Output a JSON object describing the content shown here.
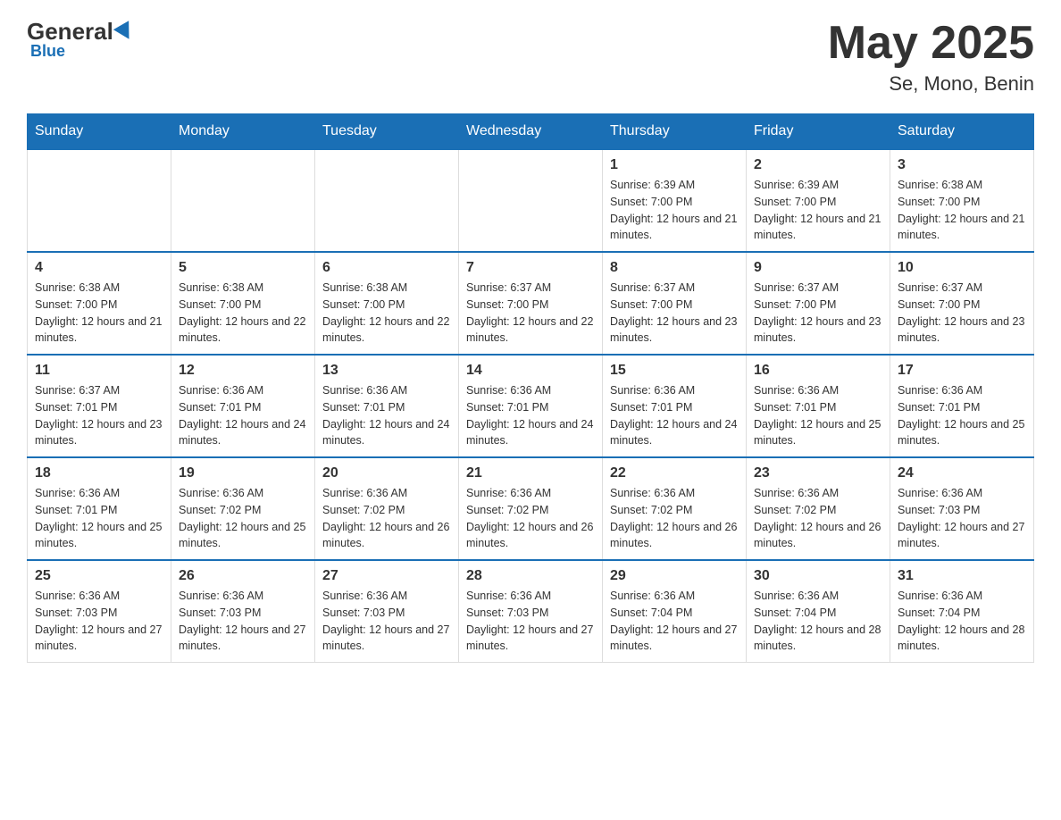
{
  "header": {
    "logo": {
      "general": "General",
      "blue": "Blue"
    },
    "title": "May 2025",
    "location": "Se, Mono, Benin"
  },
  "weekdays": [
    "Sunday",
    "Monday",
    "Tuesday",
    "Wednesday",
    "Thursday",
    "Friday",
    "Saturday"
  ],
  "weeks": [
    [
      {
        "day": "",
        "info": ""
      },
      {
        "day": "",
        "info": ""
      },
      {
        "day": "",
        "info": ""
      },
      {
        "day": "",
        "info": ""
      },
      {
        "day": "1",
        "sunrise": "6:39 AM",
        "sunset": "7:00 PM",
        "daylight": "12 hours and 21 minutes."
      },
      {
        "day": "2",
        "sunrise": "6:39 AM",
        "sunset": "7:00 PM",
        "daylight": "12 hours and 21 minutes."
      },
      {
        "day": "3",
        "sunrise": "6:38 AM",
        "sunset": "7:00 PM",
        "daylight": "12 hours and 21 minutes."
      }
    ],
    [
      {
        "day": "4",
        "sunrise": "6:38 AM",
        "sunset": "7:00 PM",
        "daylight": "12 hours and 21 minutes."
      },
      {
        "day": "5",
        "sunrise": "6:38 AM",
        "sunset": "7:00 PM",
        "daylight": "12 hours and 22 minutes."
      },
      {
        "day": "6",
        "sunrise": "6:38 AM",
        "sunset": "7:00 PM",
        "daylight": "12 hours and 22 minutes."
      },
      {
        "day": "7",
        "sunrise": "6:37 AM",
        "sunset": "7:00 PM",
        "daylight": "12 hours and 22 minutes."
      },
      {
        "day": "8",
        "sunrise": "6:37 AM",
        "sunset": "7:00 PM",
        "daylight": "12 hours and 23 minutes."
      },
      {
        "day": "9",
        "sunrise": "6:37 AM",
        "sunset": "7:00 PM",
        "daylight": "12 hours and 23 minutes."
      },
      {
        "day": "10",
        "sunrise": "6:37 AM",
        "sunset": "7:00 PM",
        "daylight": "12 hours and 23 minutes."
      }
    ],
    [
      {
        "day": "11",
        "sunrise": "6:37 AM",
        "sunset": "7:01 PM",
        "daylight": "12 hours and 23 minutes."
      },
      {
        "day": "12",
        "sunrise": "6:36 AM",
        "sunset": "7:01 PM",
        "daylight": "12 hours and 24 minutes."
      },
      {
        "day": "13",
        "sunrise": "6:36 AM",
        "sunset": "7:01 PM",
        "daylight": "12 hours and 24 minutes."
      },
      {
        "day": "14",
        "sunrise": "6:36 AM",
        "sunset": "7:01 PM",
        "daylight": "12 hours and 24 minutes."
      },
      {
        "day": "15",
        "sunrise": "6:36 AM",
        "sunset": "7:01 PM",
        "daylight": "12 hours and 24 minutes."
      },
      {
        "day": "16",
        "sunrise": "6:36 AM",
        "sunset": "7:01 PM",
        "daylight": "12 hours and 25 minutes."
      },
      {
        "day": "17",
        "sunrise": "6:36 AM",
        "sunset": "7:01 PM",
        "daylight": "12 hours and 25 minutes."
      }
    ],
    [
      {
        "day": "18",
        "sunrise": "6:36 AM",
        "sunset": "7:01 PM",
        "daylight": "12 hours and 25 minutes."
      },
      {
        "day": "19",
        "sunrise": "6:36 AM",
        "sunset": "7:02 PM",
        "daylight": "12 hours and 25 minutes."
      },
      {
        "day": "20",
        "sunrise": "6:36 AM",
        "sunset": "7:02 PM",
        "daylight": "12 hours and 26 minutes."
      },
      {
        "day": "21",
        "sunrise": "6:36 AM",
        "sunset": "7:02 PM",
        "daylight": "12 hours and 26 minutes."
      },
      {
        "day": "22",
        "sunrise": "6:36 AM",
        "sunset": "7:02 PM",
        "daylight": "12 hours and 26 minutes."
      },
      {
        "day": "23",
        "sunrise": "6:36 AM",
        "sunset": "7:02 PM",
        "daylight": "12 hours and 26 minutes."
      },
      {
        "day": "24",
        "sunrise": "6:36 AM",
        "sunset": "7:03 PM",
        "daylight": "12 hours and 27 minutes."
      }
    ],
    [
      {
        "day": "25",
        "sunrise": "6:36 AM",
        "sunset": "7:03 PM",
        "daylight": "12 hours and 27 minutes."
      },
      {
        "day": "26",
        "sunrise": "6:36 AM",
        "sunset": "7:03 PM",
        "daylight": "12 hours and 27 minutes."
      },
      {
        "day": "27",
        "sunrise": "6:36 AM",
        "sunset": "7:03 PM",
        "daylight": "12 hours and 27 minutes."
      },
      {
        "day": "28",
        "sunrise": "6:36 AM",
        "sunset": "7:03 PM",
        "daylight": "12 hours and 27 minutes."
      },
      {
        "day": "29",
        "sunrise": "6:36 AM",
        "sunset": "7:04 PM",
        "daylight": "12 hours and 27 minutes."
      },
      {
        "day": "30",
        "sunrise": "6:36 AM",
        "sunset": "7:04 PM",
        "daylight": "12 hours and 28 minutes."
      },
      {
        "day": "31",
        "sunrise": "6:36 AM",
        "sunset": "7:04 PM",
        "daylight": "12 hours and 28 minutes."
      }
    ]
  ]
}
